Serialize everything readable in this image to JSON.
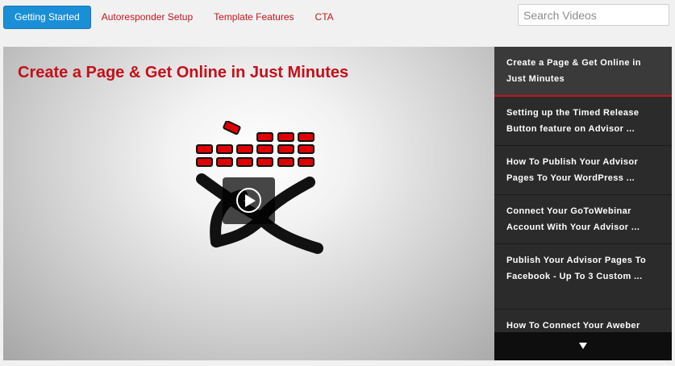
{
  "tabs": [
    {
      "label": "Getting Started",
      "active": true
    },
    {
      "label": "Autoresponder Setup",
      "active": false
    },
    {
      "label": "Template Features",
      "active": false
    },
    {
      "label": "CTA",
      "active": false
    }
  ],
  "search": {
    "placeholder": "Search Videos"
  },
  "video": {
    "title": "Create a Page & Get Online in Just Minutes"
  },
  "playlist": {
    "items": [
      {
        "label": "Create a Page & Get Online in Just Minutes"
      },
      {
        "label": "Setting up the Timed Release Button feature on Advisor ..."
      },
      {
        "label": "How To Publish Your Advisor Pages To Your WordPress ..."
      },
      {
        "label": "Connect Your GoToWebinar Account With Your Advisor ..."
      },
      {
        "label": "Publish Your Advisor Pages To Facebook - Up To 3 Custom ..."
      },
      {
        "label": "How To Connect Your Aweber Account"
      }
    ]
  },
  "colors": {
    "accent": "#1a8fd8",
    "brand_red": "#c4161c",
    "playlist_bg": "#2b2b2b"
  }
}
